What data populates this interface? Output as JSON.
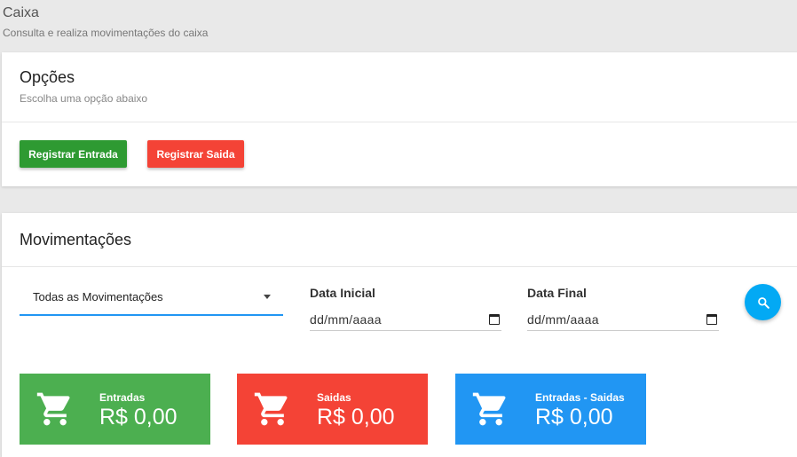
{
  "header": {
    "title": "Caixa",
    "subtitle": "Consulta e realiza movimentações do caixa"
  },
  "opcoes": {
    "title": "Opções",
    "subtitle": "Escolha uma opção abaixo",
    "btn_entrada": "Registrar Entrada",
    "btn_saida": "Registrar Saida"
  },
  "movimentacoes": {
    "title": "Movimentações",
    "filter": {
      "selected": "Todas as Movimentações"
    },
    "data_inicial": {
      "label": "Data Inicial",
      "value": "dd/mm/aaaa"
    },
    "data_final": {
      "label": "Data Final",
      "value": "dd/mm/aaaa"
    },
    "stats": [
      {
        "label": "Entradas",
        "value": "R$ 0,00",
        "color": "#4caf50",
        "icon": "cart-icon"
      },
      {
        "label": "Saidas",
        "value": "R$ 0,00",
        "color": "#f44336",
        "icon": "cart-icon"
      },
      {
        "label": "Entradas - Saidas",
        "value": "R$ 0,00",
        "color": "#2196f3",
        "icon": "cart-icon"
      }
    ]
  },
  "colors": {
    "background": "#e9e9e9",
    "success": "#2e9a32",
    "danger": "#f44336",
    "primary": "#2196f3",
    "search": "#03a9f4"
  }
}
